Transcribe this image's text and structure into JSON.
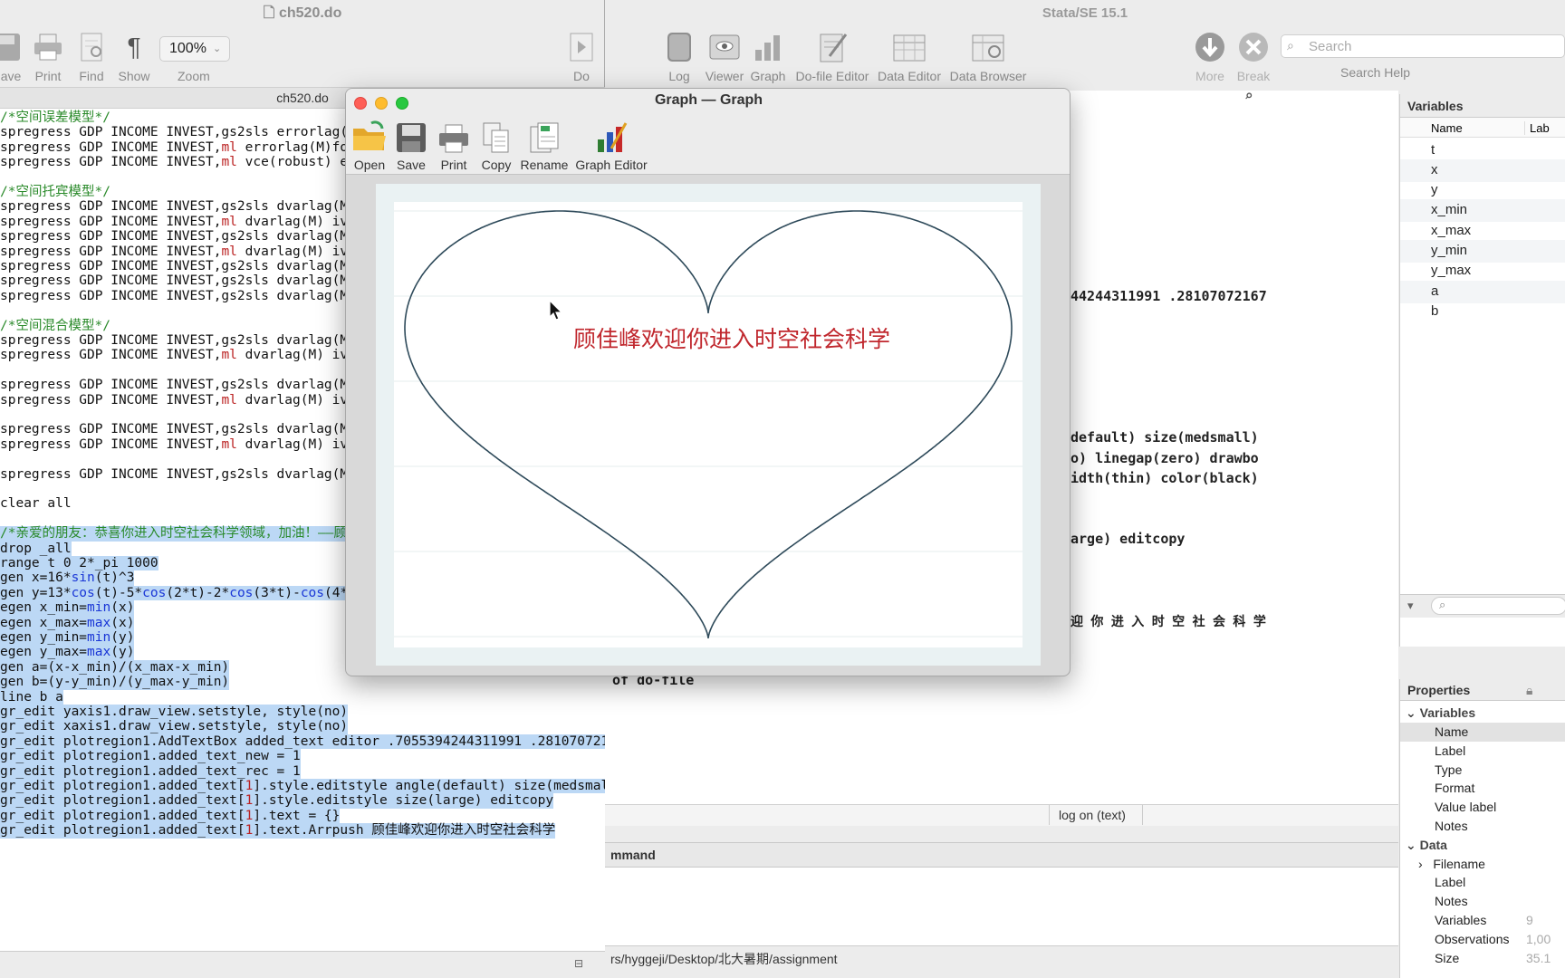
{
  "stata": {
    "title": "Stata/SE 15.1",
    "toolbar": [
      {
        "label": "Log",
        "icon": "log-icon"
      },
      {
        "label": "Viewer",
        "icon": "viewer-icon"
      },
      {
        "label": "Graph",
        "icon": "graph-icon"
      },
      {
        "label": "Do-file Editor",
        "icon": "dofile-editor-icon"
      },
      {
        "label": "Data Editor",
        "icon": "data-editor-icon"
      },
      {
        "label": "Data Browser",
        "icon": "data-browser-icon"
      },
      {
        "label": "More",
        "icon": "download-arrow-icon"
      },
      {
        "label": "Break",
        "icon": "break-x-icon"
      }
    ],
    "search_placeholder": "Search",
    "search_help_label": "Search Help",
    "results_lines": [
      "44244311991 .28107072167",
      "default) size(medsmall)",
      "o) linegap(zero) drawbo",
      "idth(thin) color(black)",
      "arge) editcopy",
      "迎 你 进 入 时 空 社 会 科 学",
      "of do-file"
    ],
    "log_status": "log on (text)",
    "command_label": "mmand",
    "cwd": "rs/hyggeji/Desktop/北大暑期/assignment"
  },
  "variables_pane": {
    "header": "Variables",
    "col_name": "Name",
    "col_label": "Lab",
    "items": [
      "t",
      "x",
      "y",
      "x_min",
      "x_max",
      "y_min",
      "y_max",
      "a",
      "b"
    ]
  },
  "properties_pane": {
    "header": "Properties",
    "sections": [
      {
        "title": "Variables",
        "rows": [
          "Name",
          "Label",
          "Type",
          "Format",
          "Value label",
          "Notes"
        ]
      },
      {
        "title": "Data",
        "rows": [
          "Filename",
          "Label",
          "Notes",
          "Variables",
          "Observations",
          "Size"
        ]
      }
    ],
    "values": {
      "Variables": "9",
      "Observations": "1,00",
      "Size": "35.1"
    }
  },
  "editor": {
    "title": "ch520.do",
    "tab": "ch520.do",
    "zoom": "100%",
    "toolbar": [
      {
        "label": "ave",
        "icon": "save-icon"
      },
      {
        "label": "Print",
        "icon": "print-icon"
      },
      {
        "label": "Find",
        "icon": "find-icon"
      },
      {
        "label": "Show",
        "icon": "pilcrow-icon"
      },
      {
        "label": "Zoom",
        "icon": "zoom-icon"
      },
      {
        "label": "Do",
        "icon": "do-run-icon"
      }
    ]
  },
  "code_lines": [
    {
      "t": "/*空间误差模型*/",
      "c": "cmt"
    },
    {
      "t": "spregress GDP INCOME INVEST,gs2sls errorlag(M"
    },
    {
      "t": "spregress GDP INCOME INVEST,ml errorlag(M)for"
    },
    {
      "t": "spregress GDP INCOME INVEST,ml vce(robust) er"
    },
    {
      "t": ""
    },
    {
      "t": "/*空间托宾模型*/",
      "c": "cmt"
    },
    {
      "t": "spregress GDP INCOME INVEST,gs2sls dvarlag(M)"
    },
    {
      "t": "spregress GDP INCOME INVEST,ml dvarlag(M) iva"
    },
    {
      "t": "spregress GDP INCOME INVEST,gs2sls dvarlag(M)"
    },
    {
      "t": "spregress GDP INCOME INVEST,ml dvarlag(M) iva"
    },
    {
      "t": "spregress GDP INCOME INVEST,gs2sls dvarlag(M)"
    },
    {
      "t": "spregress GDP INCOME INVEST,gs2sls dvarlag(M)"
    },
    {
      "t": "spregress GDP INCOME INVEST,gs2sls dvarlag(M)"
    },
    {
      "t": ""
    },
    {
      "t": "/*空间混合模型*/",
      "c": "cmt"
    },
    {
      "t": "spregress GDP INCOME INVEST,gs2sls dvarlag(M)"
    },
    {
      "t": "spregress GDP INCOME INVEST,ml dvarlag(M) iva"
    },
    {
      "t": ""
    },
    {
      "t": "spregress GDP INCOME INVEST,gs2sls dvarlag(M)"
    },
    {
      "t": "spregress GDP INCOME INVEST,ml dvarlag(M) iva"
    },
    {
      "t": ""
    },
    {
      "t": "spregress GDP INCOME INVEST,gs2sls dvarlag(M)"
    },
    {
      "t": "spregress GDP INCOME INVEST,ml dvarlag(M) iva"
    },
    {
      "t": ""
    },
    {
      "t": "spregress GDP INCOME INVEST,gs2sls dvarlag(M)"
    },
    {
      "t": ""
    },
    {
      "t": "clear all"
    },
    {
      "t": ""
    },
    {
      "t": "/*亲爱的朋友：恭喜你进入时空社会科学领域，加油！——顾",
      "c": "cmt",
      "sel": true
    },
    {
      "t": "drop _all",
      "sel": true
    },
    {
      "t": "range t 0 2*_pi 1000",
      "sel": true
    },
    {
      "t": "gen x=16*sin(t)^3",
      "sel": true
    },
    {
      "t": "gen y=13*cos(t)-5*cos(2*t)-2*cos(3*t)-cos(4*t",
      "sel": true
    },
    {
      "t": "egen x_min=min(x)",
      "sel": true
    },
    {
      "t": "egen x_max=max(x)",
      "sel": true
    },
    {
      "t": "egen y_min=min(y)",
      "sel": true
    },
    {
      "t": "egen y_max=max(y)",
      "sel": true
    },
    {
      "t": "gen a=(x-x_min)/(x_max-x_min)",
      "sel": true
    },
    {
      "t": "gen b=(y-y_min)/(y_max-y_min)",
      "sel": true
    },
    {
      "t": "line b a",
      "sel": true
    },
    {
      "t": "gr_edit yaxis1.draw_view.setstyle, style(no)",
      "sel": true
    },
    {
      "t": "gr_edit xaxis1.draw_view.setstyle, style(no)",
      "sel": true
    },
    {
      "t": "gr_edit plotregion1.AddTextBox added_text editor .7055394244311991 .28107072167",
      "sel": true
    },
    {
      "t": "gr_edit plotregion1.added_text_new = 1",
      "sel": true
    },
    {
      "t": "gr_edit plotregion1.added_text_rec = 1",
      "sel": true
    },
    {
      "t": "gr_edit plotregion1.added_text[1].style.editstyle angle(default) size(medsmall)",
      "sel": true
    },
    {
      "t": "gr_edit plotregion1.added_text[1].style.editstyle size(large) editcopy",
      "sel": true
    },
    {
      "t": "gr_edit plotregion1.added_text[1].text = {}",
      "sel": true
    },
    {
      "t": "gr_edit plotregion1.added_text[1].text.Arrpush 顾佳峰欢迎你进入时空社会科学",
      "sel": true
    }
  ],
  "graph_window": {
    "title": "Graph — Graph",
    "toolbar": [
      {
        "label": "Open",
        "icon": "open-folder-icon"
      },
      {
        "label": "Save",
        "icon": "save-disk-icon"
      },
      {
        "label": "Print",
        "icon": "printer-icon"
      },
      {
        "label": "Copy",
        "icon": "copy-icon"
      },
      {
        "label": "Rename",
        "icon": "rename-icon"
      },
      {
        "label": "Graph Editor",
        "icon": "graph-editor-icon"
      }
    ],
    "annotation": "顾佳峰欢迎你进入时空社会科学",
    "annotation_color": "#c0272d",
    "line_color": "#2e4a5a"
  }
}
